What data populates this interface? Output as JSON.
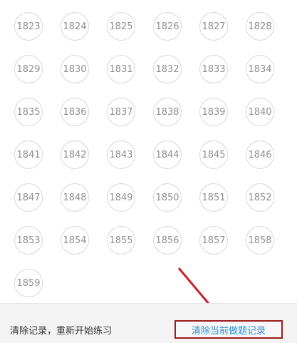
{
  "questions": [
    "1823",
    "1824",
    "1825",
    "1826",
    "1827",
    "1828",
    "1829",
    "1830",
    "1831",
    "1832",
    "1833",
    "1834",
    "1835",
    "1836",
    "1837",
    "1838",
    "1839",
    "1840",
    "1841",
    "1842",
    "1843",
    "1844",
    "1845",
    "1846",
    "1847",
    "1848",
    "1849",
    "1850",
    "1851",
    "1852",
    "1853",
    "1854",
    "1855",
    "1856",
    "1857",
    "1858",
    "1859"
  ],
  "footer": {
    "reset_text": "清除记录，重新开始练习",
    "clear_link": "清除当前做题记录"
  },
  "colors": {
    "circle_border": "#d7d7d7",
    "circle_text": "#8f8f8f",
    "link": "#2f8fd6",
    "highlight_box": "#9c1b1b",
    "arrow": "#c8202a"
  }
}
